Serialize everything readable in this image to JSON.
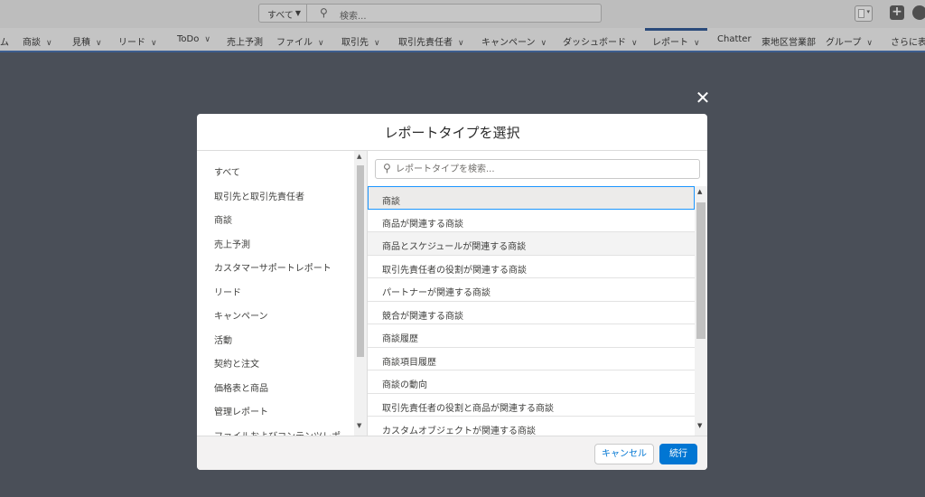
{
  "header": {
    "search_scope": "すべて",
    "search_placeholder": "検索..."
  },
  "nav": {
    "items": [
      {
        "label": "ム",
        "dropdown": false
      },
      {
        "label": "商談",
        "dropdown": true
      },
      {
        "label": "見積",
        "dropdown": true
      },
      {
        "label": "リード",
        "dropdown": true
      },
      {
        "label": "ToDo",
        "dropdown": true
      },
      {
        "label": "売上予測",
        "dropdown": false
      },
      {
        "label": "ファイル",
        "dropdown": true
      },
      {
        "label": "取引先",
        "dropdown": true
      },
      {
        "label": "取引先責任者",
        "dropdown": true
      },
      {
        "label": "キャンペーン",
        "dropdown": true
      },
      {
        "label": "ダッシュボード",
        "dropdown": true
      },
      {
        "label": "レポート",
        "dropdown": true
      },
      {
        "label": "Chatter",
        "dropdown": false
      },
      {
        "label": "東地区営業部",
        "dropdown": false
      },
      {
        "label": "グループ",
        "dropdown": true
      },
      {
        "label": "さらに表",
        "dropdown": false
      }
    ],
    "active": "レポート"
  },
  "modal": {
    "title": "レポートタイプを選択",
    "close_icon": "close-icon",
    "search_placeholder": "レポートタイプを検索...",
    "categories": [
      "すべて",
      "取引先と取引先責任者",
      "商談",
      "売上予測",
      "カスタマーサポートレポート",
      "リード",
      "キャンペーン",
      "活動",
      "契約と注文",
      "価格表と商品",
      "管理レポート",
      "ファイルおよびコンテンツレポ"
    ],
    "report_types": [
      "商談",
      "商品が関連する商談",
      "商品とスケジュールが関連する商談",
      "取引先責任者の役割が関連する商談",
      "パートナーが関連する商談",
      "競合が関連する商談",
      "商談履歴",
      "商談項目履歴",
      "商談の動向",
      "取引先責任者の役割と商品が関連する商談",
      "カスタムオブジェクトが関連する商談"
    ],
    "selected_report_type": "商談",
    "cancel_label": "キャンセル",
    "next_label": "続行"
  },
  "colors": {
    "brand_blue": "#0176d3",
    "selection_border": "#1b96ff",
    "overlay": "#4a4f58"
  }
}
